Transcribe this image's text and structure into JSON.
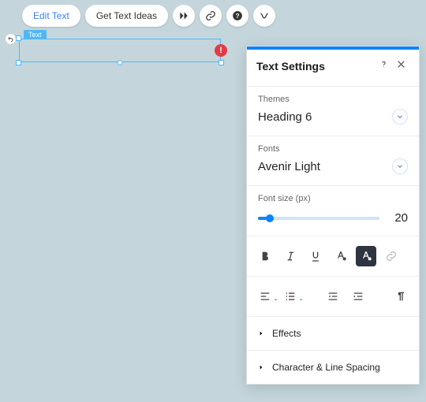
{
  "toolbar": {
    "edit_text": "Edit Text",
    "get_text_ideas": "Get Text Ideas"
  },
  "selection": {
    "label": "Text",
    "warning": "!"
  },
  "panel": {
    "title": "Text Settings",
    "themes_label": "Themes",
    "themes_value": "Heading 6",
    "fonts_label": "Fonts",
    "fonts_value": "Avenir Light",
    "fontsize_label": "Font size (px)",
    "fontsize_value": "20",
    "effects": "Effects",
    "char_spacing": "Character & Line Spacing"
  }
}
